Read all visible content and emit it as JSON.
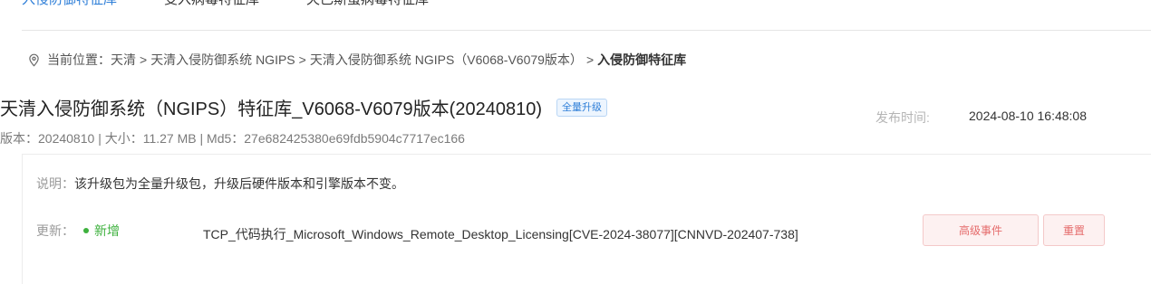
{
  "tabs": [
    {
      "label": "入侵防御特征库"
    },
    {
      "label": "变入病毒特征库"
    },
    {
      "label": "天已斯蛋病毒特征库"
    }
  ],
  "breadcrumb": {
    "prefix": "当前位置：",
    "items": [
      "天清",
      "天清入侵防御系统 NGIPS",
      "天清入侵防御系统 NGIPS（V6068-V6079版本）"
    ],
    "separator": ">",
    "current": "入侵防御特征库"
  },
  "product": {
    "title": "天清入侵防御系统（NGIPS）特征库_V6068-V6079版本(20240810)",
    "badge": "全量升级",
    "version_label": "版本：",
    "version": "20240810",
    "size_label": "大小：",
    "size": "11.27 MB",
    "md5_label": "Md5：",
    "md5": "27e682425380e69fdb5904c7717ec166",
    "publish_label": "发布时间:",
    "publish_time": "2024-08-10 16:48:08"
  },
  "details": {
    "desc_label": "说明：",
    "desc_text": "该升级包为全量升级包，升级后硬件版本和引擎版本不变。",
    "update_label": "更新：",
    "update_type": "新增",
    "update_text": "TCP_代码执行_Microsoft_Windows_Remote_Desktop_Licensing[CVE-2024-38077][CNNVD-202407-738]",
    "tags": [
      "高级事件",
      "重置"
    ]
  },
  "colors": {
    "accent": "#2f7fd8",
    "added": "#3db13d",
    "tag_text": "#e56b6b",
    "tag_bg": "#fdf1f1"
  }
}
